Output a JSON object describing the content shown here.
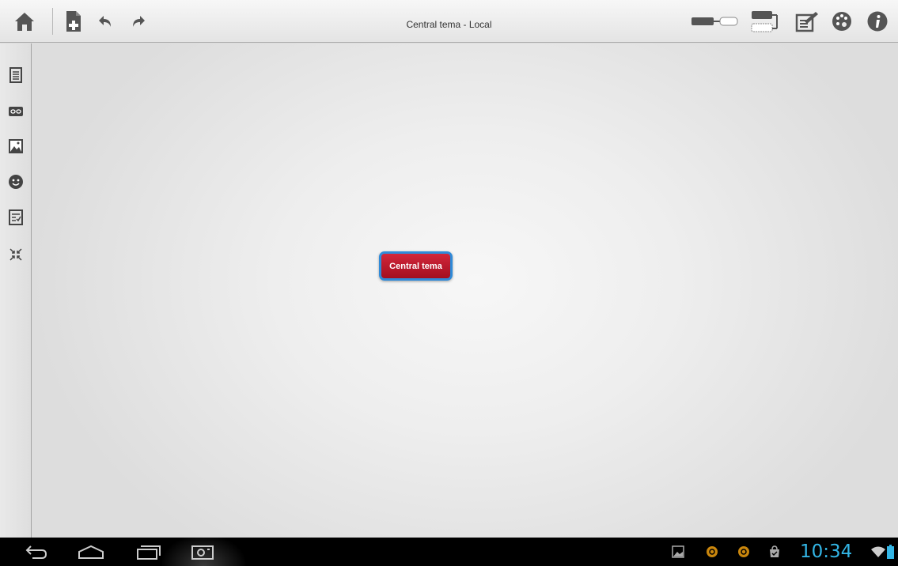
{
  "toolbar": {
    "title": "Central tema - Local",
    "icons": [
      "home-icon",
      "new-file-icon",
      "undo-icon",
      "redo-icon",
      "connect-icon",
      "layout-icon",
      "edit-note-icon",
      "palette-icon",
      "info-icon"
    ]
  },
  "sidebar": {
    "icons": [
      "notes-icon",
      "link-icon",
      "image-icon",
      "emoji-icon",
      "task-icon",
      "collapse-icon"
    ]
  },
  "canvas": {
    "central_node": "Central tema"
  },
  "navbar": {
    "icons": [
      "back-icon",
      "home-icon",
      "recent-apps-icon",
      "screenshot-icon"
    ]
  },
  "status_bar": {
    "time": "10:34",
    "icons": [
      "gallery-notification-icon",
      "app-notification-icon",
      "app-notification-icon",
      "store-notification-icon",
      "wifi-icon",
      "battery-icon"
    ]
  },
  "colors": {
    "node_fill": "#b8182b",
    "node_border": "#2f8ad8",
    "clock": "#33b5e5"
  }
}
